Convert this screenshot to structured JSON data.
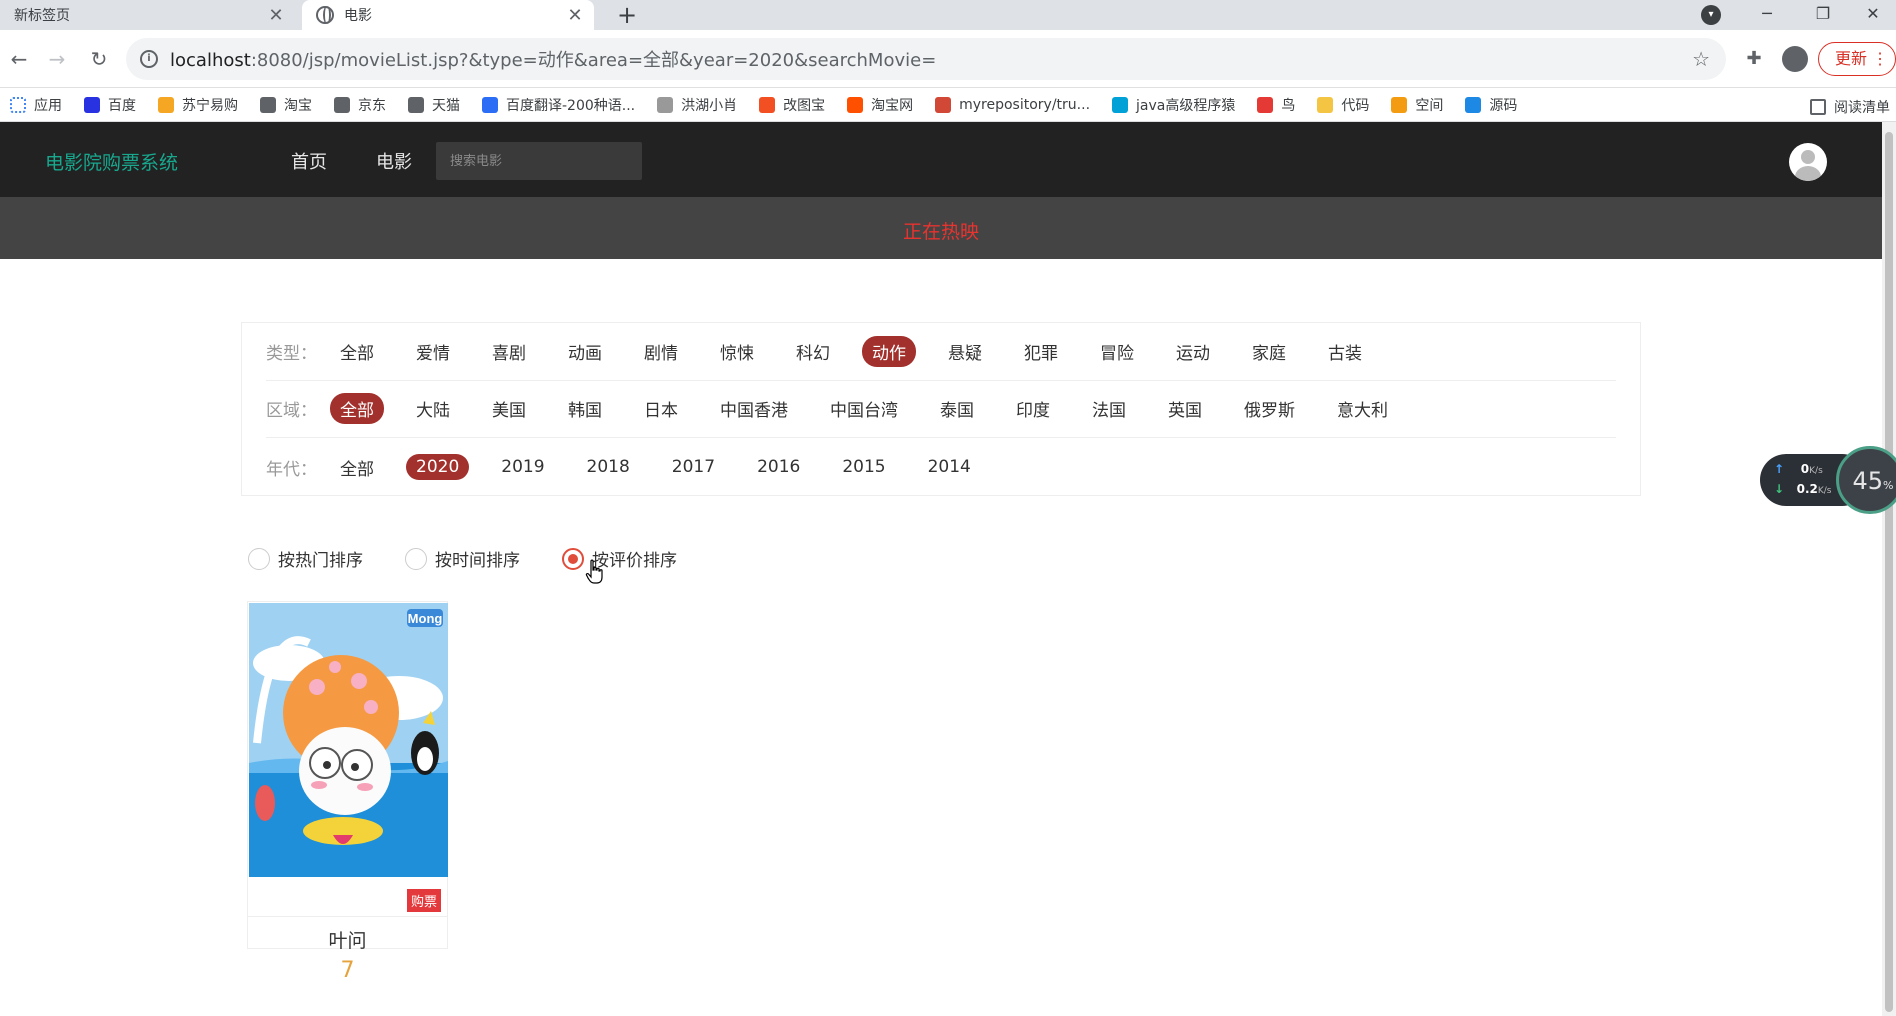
{
  "browser": {
    "tabs": [
      {
        "title": "新标签页",
        "active": false
      },
      {
        "title": "电影",
        "active": true
      }
    ],
    "url_host": "localhost",
    "url_rest": ":8080/jsp/movieList.jsp?&type=动作&area=全部&year=2020&searchMovie=",
    "update_label": "更新",
    "reading_list_label": "阅读清单",
    "bookmarks": [
      {
        "label": "应用",
        "color": "#4285f4"
      },
      {
        "label": "百度",
        "color": "#2932e1"
      },
      {
        "label": "苏宁易购",
        "color": "#f5a623"
      },
      {
        "label": "淘宝",
        "color": "#5f6368"
      },
      {
        "label": "京东",
        "color": "#5f6368"
      },
      {
        "label": "天猫",
        "color": "#5f6368"
      },
      {
        "label": "百度翻译-200种语...",
        "color": "#2b6ef5"
      },
      {
        "label": "洪湖小肖",
        "color": "#999999"
      },
      {
        "label": "改图宝",
        "color": "#f25022"
      },
      {
        "label": "淘宝网",
        "color": "#ff5000"
      },
      {
        "label": "myrepository/tru...",
        "color": "#d14836"
      },
      {
        "label": "java高级程序猿",
        "color": "#00a1d6"
      },
      {
        "label": "鸟",
        "color": "#e53935"
      },
      {
        "label": "代码",
        "color": "#f4c542"
      },
      {
        "label": "空间",
        "color": "#f39c12"
      },
      {
        "label": "源码",
        "color": "#1e88e5"
      }
    ]
  },
  "site": {
    "brand": "电影院购票系统",
    "nav": [
      "首页",
      "电影"
    ],
    "search_placeholder": "搜索电影",
    "hero_title": "正在热映"
  },
  "filters": {
    "type": {
      "label": "类型：",
      "options": [
        "全部",
        "爱情",
        "喜剧",
        "动画",
        "剧情",
        "惊悚",
        "科幻",
        "动作",
        "悬疑",
        "犯罪",
        "冒险",
        "运动",
        "家庭",
        "古装"
      ],
      "selected": "动作"
    },
    "area": {
      "label": "区域：",
      "options": [
        "全部",
        "大陆",
        "美国",
        "韩国",
        "日本",
        "中国香港",
        "中国台湾",
        "泰国",
        "印度",
        "法国",
        "英国",
        "俄罗斯",
        "意大利"
      ],
      "selected": "全部"
    },
    "year": {
      "label": "年代：",
      "options": [
        "全部",
        "2020",
        "2019",
        "2018",
        "2017",
        "2016",
        "2015",
        "2014"
      ],
      "selected": "2020"
    }
  },
  "sort": {
    "options": [
      "按热门排序",
      "按时间排序",
      "按评价排序"
    ],
    "selected": "按评价排序"
  },
  "movies": [
    {
      "name": "叶问",
      "score": "7",
      "buy_label": "购票",
      "poster_logo": "Mong"
    }
  ],
  "netmon": {
    "up": "0",
    "down": "0.2",
    "unit": "K/s",
    "percent": "45",
    "percent_unit": "%"
  },
  "colors": {
    "accent": "#a2302c",
    "brand": "#17a88e",
    "hero_text": "#e8332f",
    "score": "#e6a23c",
    "buy": "#e4393c"
  }
}
